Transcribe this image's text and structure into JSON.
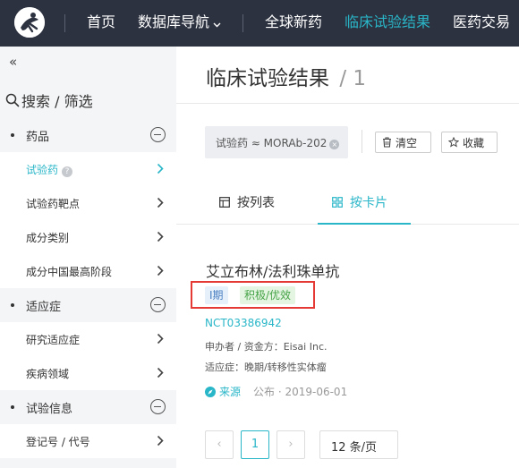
{
  "nav": {
    "items": [
      "首页",
      "数据库导航",
      "全球新药",
      "临床试验结果",
      "医药交易"
    ],
    "active_index": 3,
    "accent": "#29b6c8",
    "background": "#2d3240"
  },
  "sidebar": {
    "collapse_glyph": "«",
    "search_label": "搜索 / 筛选",
    "sections": [
      {
        "label": "药品",
        "items": [
          {
            "label": "试验药",
            "active": true,
            "help": "?"
          },
          {
            "label": "试验药靶点"
          },
          {
            "label": "成分类别"
          },
          {
            "label": "成分中国最高阶段"
          }
        ]
      },
      {
        "label": "适应症",
        "items": [
          {
            "label": "研究适应症"
          },
          {
            "label": "疾病领域"
          }
        ]
      },
      {
        "label": "试验信息",
        "items": [
          {
            "label": "登记号 / 代号"
          }
        ]
      }
    ]
  },
  "main": {
    "title": "临床试验结果",
    "title_sep": "/",
    "result_count": "1",
    "filter_chip": {
      "label": "试验药 ≈ MORAb-202",
      "remove": "×"
    },
    "clear_label": "清空",
    "favorite_label": "收藏",
    "tabs": [
      {
        "label": "按列表",
        "icon": "table-icon"
      },
      {
        "label": "按卡片",
        "icon": "grid-icon",
        "active": true
      }
    ],
    "card": {
      "title": "艾立布林/法利珠单抗",
      "phase_tag": "I期",
      "result_tag": "积极/优效",
      "nct": "NCT03386942",
      "sponsor": "申办者 / 资金方：Eisai Inc.",
      "indication": "适应症：晚期/转移性实体瘤",
      "source_label": "来源",
      "published": "公布 · 2019-06-01"
    },
    "pagination": {
      "prev": "‹",
      "current_page": "1",
      "next": "›",
      "page_size": "12 条/页"
    }
  }
}
